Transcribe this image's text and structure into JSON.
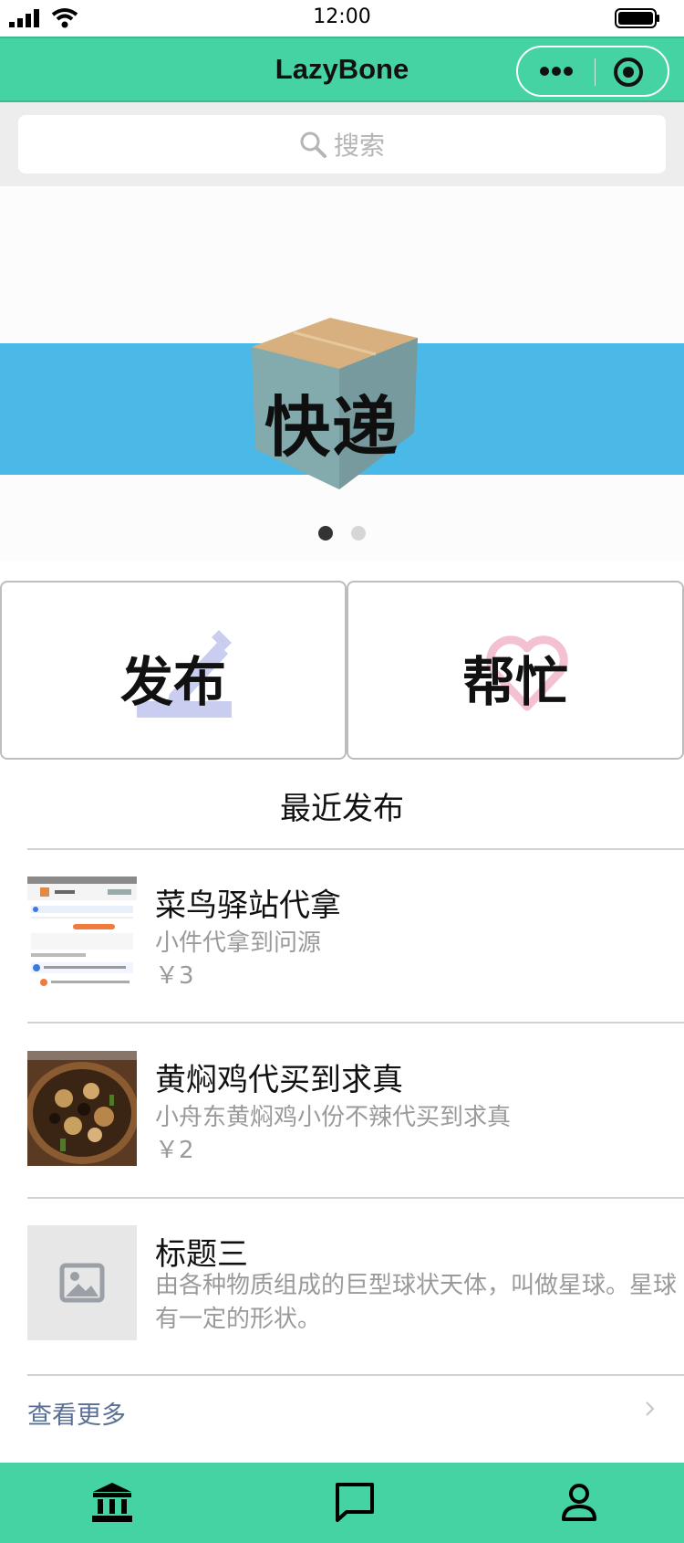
{
  "status_bar": {
    "time": "12:00"
  },
  "nav": {
    "title": "LazyBone"
  },
  "search": {
    "placeholder": "搜索"
  },
  "banner": {
    "text": "快递",
    "active_slide": 1,
    "slide_count": 2
  },
  "actions": {
    "publish_label": "发布",
    "help_label": "帮忙"
  },
  "recent": {
    "title": "最近发布",
    "items": [
      {
        "name": "菜鸟驿站代拿",
        "desc": "小件代拿到问源",
        "price": "￥3"
      },
      {
        "name": "黄焖鸡代买到求真",
        "desc": "小舟东黄焖鸡小份不辣代买到求真",
        "price": "￥2"
      },
      {
        "name": "标题三",
        "desc": "由各种物质组成的巨型球状天体，叫做星球。星球有一定的形状。"
      }
    ],
    "more_label": "查看更多"
  },
  "colors": {
    "nav_green": "#45d3a3",
    "banner_blue": "#4ab9e8",
    "link_blue": "#5b6f95"
  },
  "tabs": [
    {
      "icon": "bank-icon"
    },
    {
      "icon": "message-icon"
    },
    {
      "icon": "user-icon"
    }
  ]
}
